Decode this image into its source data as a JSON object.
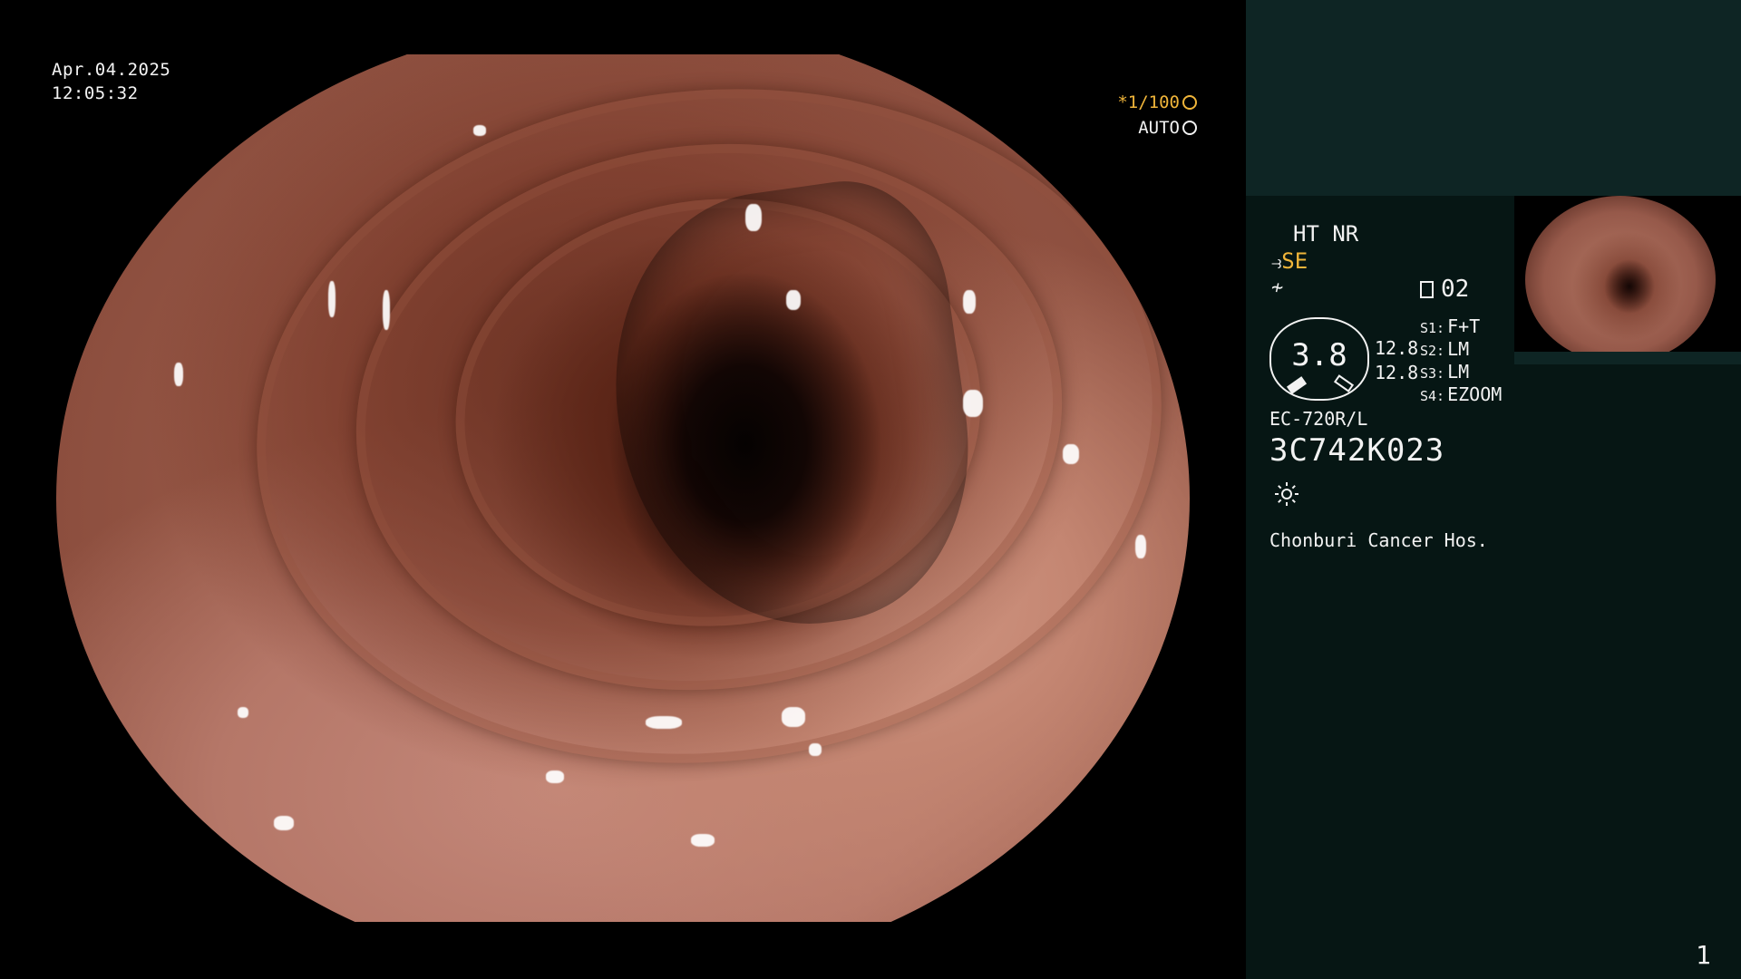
{
  "osd": {
    "date": "Apr.04.2025",
    "time": "12:05:32",
    "shutter": "*1/100",
    "exposure": "AUTO",
    "colors": {
      "shutter": "#f0b53a",
      "text": "#f2f2f2"
    }
  },
  "panel": {
    "mode": "HT NR",
    "se": "SE",
    "channel": "02",
    "gauge_value": "3.8",
    "measurements": [
      "12.8",
      "12.8"
    ],
    "slots": [
      {
        "key": "S1:",
        "value": "F+T"
      },
      {
        "key": "S2:",
        "value": "LM"
      },
      {
        "key": "S3:",
        "value": "LM"
      },
      {
        "key": "S4:",
        "value": "EZOOM"
      }
    ],
    "scope_model": "EC-720R/L",
    "scope_serial": "3C742K023",
    "hospital": "Chonburi Cancer Hos.",
    "page": "1",
    "icons": [
      "se-mode-icon",
      "enhance-icon",
      "document-icon",
      "lamp-icon",
      "shutter-icon",
      "auto-exposure-icon"
    ]
  }
}
